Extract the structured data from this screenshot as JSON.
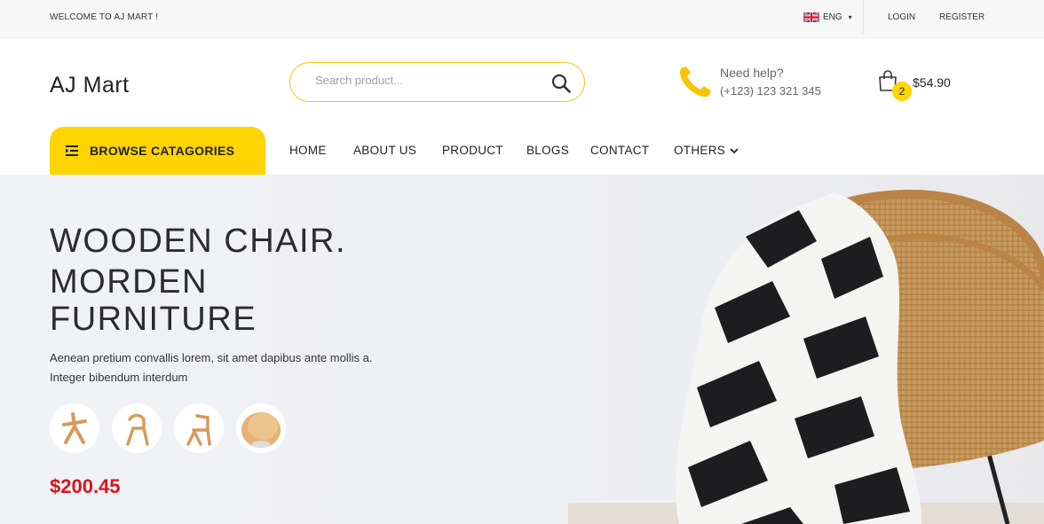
{
  "topbar": {
    "welcome": "WELCOME TO AJ MART !",
    "language": "ENG",
    "login": "LOGIN",
    "register": "REGISTER"
  },
  "header": {
    "logo": "AJ Mart",
    "search_placeholder": "Search product...",
    "help_title": "Need help?",
    "help_phone": "(+123) 123 321 345",
    "cart_count": "2",
    "cart_total": "$54.90"
  },
  "nav": {
    "browse_label": "BROWSE CATAGORIES",
    "items": [
      "HOME",
      "ABOUT US",
      "PRODUCT",
      "BLOGS",
      "CONTACT",
      "OTHERS"
    ]
  },
  "hero": {
    "title_lines": [
      "WOODEN CHAIR.",
      "MORDEN",
      "FURNITURE"
    ],
    "description": "Aenean pretium convallis lorem, sit amet dapibus ante mollis a. Integer bibendum interdum",
    "price": "$200.45"
  },
  "icons": {
    "search": "search-icon",
    "phone": "phone-icon",
    "cart": "shopping-bag-icon",
    "browse": "menu-list-icon",
    "others": "chevron-down-icon",
    "language": "uk-flag-icon"
  },
  "colors": {
    "accent": "#ffd400",
    "search_border": "#f5c518",
    "price": "#d8141d"
  }
}
